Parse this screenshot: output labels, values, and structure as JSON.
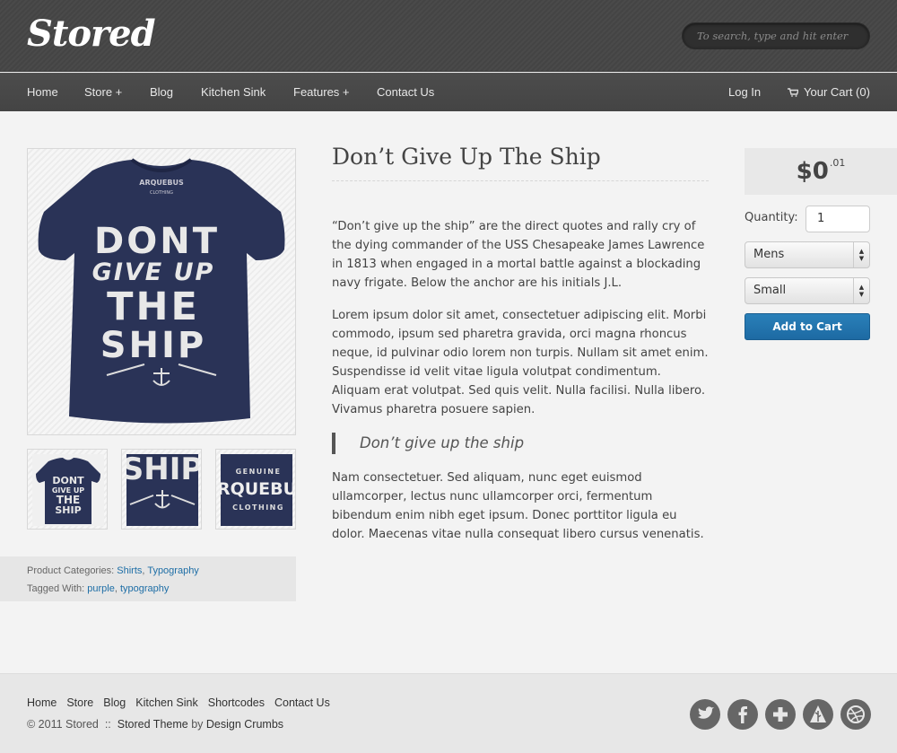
{
  "header": {
    "logo": "Stored",
    "search_placeholder": "To search, type and hit enter"
  },
  "nav": {
    "left": [
      "Home",
      "Store +",
      "Blog",
      "Kitchen Sink",
      "Features +",
      "Contact Us"
    ],
    "login": "Log In",
    "cart": "Your Cart (0)"
  },
  "product": {
    "title": "Don’t Give Up The Ship",
    "image_text": [
      "DONT",
      "GIVE UP",
      "THE",
      "SHIP"
    ],
    "thumb_texts": {
      "thumb1": [
        "DONT",
        "GIVE UP",
        "THE",
        "SHIP"
      ],
      "thumb2": "SHIP",
      "thumb3": [
        "GENUINE",
        "ARQUEBUS",
        "CLOTHING"
      ]
    },
    "paragraph1": "“Don’t give up the ship” are the direct quotes and rally cry of the dying commander of the USS Chesapeake James Lawrence in 1813 when engaged in a mortal battle against a blockading navy frigate. Below the anchor are his initials J.L.",
    "paragraph2": "Lorem ipsum dolor sit amet, consectetuer adipiscing elit. Morbi commodo, ipsum sed pharetra gravida, orci magna rhoncus neque, id pulvinar odio lorem non turpis. Nullam sit amet enim. Suspendisse id velit vitae ligula volutpat condimentum. Aliquam erat volutpat. Sed quis velit. Nulla facilisi. Nulla libero. Vivamus pharetra posuere sapien.",
    "quote": "Don’t give up the ship",
    "paragraph3": "Nam consectetuer. Sed aliquam, nunc eget euismod ullamcorper, lectus nunc ullamcorper orci, fermentum bibendum enim nibh eget ipsum. Donec porttitor ligula eu dolor. Maecenas vitae nulla consequat libero cursus venenatis.",
    "categories_label": "Product Categories:",
    "categories": [
      "Shirts",
      "Typography"
    ],
    "tags_label": "Tagged With:",
    "tags": [
      "purple",
      "typography"
    ]
  },
  "purchase": {
    "price_main": "$0",
    "price_cents": ".01",
    "quantity_label": "Quantity:",
    "quantity_value": "1",
    "style_selected": "Mens",
    "size_selected": "Small",
    "add_to_cart": "Add to Cart"
  },
  "footer": {
    "links": [
      "Home",
      "Store",
      "Blog",
      "Kitchen Sink",
      "Shortcodes",
      "Contact Us"
    ],
    "copyright": "© 2011 Stored",
    "separator": "::",
    "theme": "Stored Theme",
    "by": "by",
    "author": "Design Crumbs",
    "social_icons": [
      "twitter-icon",
      "facebook-icon",
      "plus-icon",
      "forrst-icon",
      "dribbble-icon"
    ]
  },
  "colors": {
    "link": "#1e6ea6",
    "button": "#1d6aa3",
    "header": "#464646",
    "shirt": "#2a3357"
  }
}
